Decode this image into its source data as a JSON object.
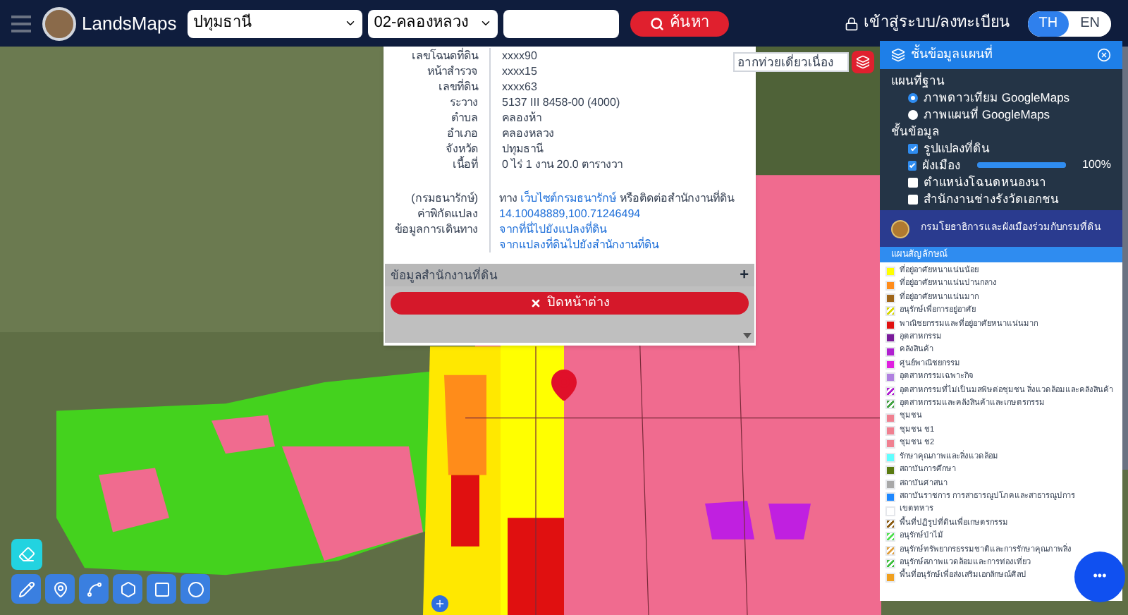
{
  "header": {
    "app_name": "LandsMaps",
    "province_select": "ปทุมธานี",
    "district_select": "02-คลองหลวง",
    "search_button": "ค้นหา",
    "login_link": "เข้าสู่ระบบ/ลงทะเบียน",
    "languages": [
      {
        "label": "TH",
        "selected": true
      },
      {
        "label": "EN",
        "selected": false
      }
    ]
  },
  "parcel_popup": {
    "rows": [
      {
        "label": "เลขโฉนดที่ดิน",
        "value": "xxxx90"
      },
      {
        "label": "หน้าสำรวจ",
        "value": "xxxx15"
      },
      {
        "label": "เลขที่ดิน",
        "value": "xxxx63"
      },
      {
        "label": "ระวาง",
        "value": "5137 III 8458-00 (4000)"
      },
      {
        "label": "ตำบล",
        "value": "คลองห้า"
      },
      {
        "label": "อำเภอ",
        "value": "คลองหลวง"
      },
      {
        "label": "จังหวัด",
        "value": "ปทุมธานี"
      },
      {
        "label": "เนื้อที่",
        "value": "0 ไร่ 1 งาน 20.0 ตารางวา"
      }
    ],
    "extra_rows": [
      {
        "label": "(กรมธนารักษ์)",
        "parts": [
          {
            "text": "ทาง ",
            "link": false
          },
          {
            "text": "เว็บไซต์กรมธนารักษ์",
            "link": true
          },
          {
            "text": " หรือติดต่อสำนักงานที่ดิน",
            "link": false
          }
        ]
      },
      {
        "label": "ค่าพิกัดแปลง",
        "parts": [
          {
            "text": "14.10048889,100.71246494",
            "link": true
          }
        ]
      },
      {
        "label": "ข้อมูลการเดินทาง",
        "parts": [
          {
            "text": "จากที่นี่ไปยังแปลงที่ดิน",
            "link": true
          }
        ]
      },
      {
        "label": "",
        "parts": [
          {
            "text": "จากแปลงที่ดินไปยังสำนักงานที่ดิน",
            "link": true
          }
        ]
      }
    ],
    "section": "ข้อมูลสำนักงานที่ดิน",
    "section_toggle": "+",
    "close_button": "ปิดหน้าต่าง"
  },
  "route_tab": "อากท่วยเดี่ยวเนื่อง",
  "layer_panel": {
    "title": "ชั้นข้อมูลแผนที่",
    "basemap_heading": "แผนที่ฐาน",
    "basemaps": [
      {
        "label": "ภาพดาวเทียม GoogleMaps",
        "selected": true
      },
      {
        "label": "ภาพแผนที่ GoogleMaps",
        "selected": false
      }
    ],
    "layers_heading": "ชั้นข้อมูล",
    "layers": [
      {
        "label": "รูปแปลงที่ดิน",
        "checked": true,
        "kind": "checkbox"
      },
      {
        "label": "ผังเมือง",
        "checked": true,
        "kind": "slider",
        "level": 1,
        "reading": "100%"
      },
      {
        "label": "ตำแหน่งโฉนดหนองนา",
        "checked": false,
        "kind": "checkbox"
      },
      {
        "label": "สำนักงานช่างรังวัดเอกชน",
        "checked": false,
        "kind": "checkbox"
      }
    ],
    "banner": "กรมโยธาธิการและผังเมืองร่วมกับกรมที่ดิน",
    "legend_heading": "แผนสัญลักษณ์",
    "legend": [
      {
        "label": "ที่อยู่อาศัยหนาแน่นน้อย",
        "color": "#ffff00",
        "kind": "solid"
      },
      {
        "label": "ที่อยู่อาศัยหนาแน่นปานกลาง",
        "color": "#ff8c1a",
        "kind": "solid"
      },
      {
        "label": "ที่อยู่อาศัยหนาแน่นมาก",
        "color": "#a0661a",
        "kind": "solid"
      },
      {
        "label": "อนุรักษ์เพื่อการอยู่อาศัย",
        "color": "#d8d800",
        "kind": "hatch"
      },
      {
        "label": "พาณิชยกรรมและที่อยู่อาศัยหนาแน่นมาก",
        "color": "#e01010",
        "kind": "solid"
      },
      {
        "label": "อุตสาหกรรม",
        "color": "#7a1a9a",
        "kind": "solid"
      },
      {
        "label": "คลังสินค้า",
        "color": "#b020d0",
        "kind": "solid"
      },
      {
        "label": "ศูนย์พาณิชยกรรม",
        "color": "#e020e0",
        "kind": "solid"
      },
      {
        "label": "อุตสาหกรรมเฉพาะกิจ",
        "color": "#b080e0",
        "kind": "solid"
      },
      {
        "label": "อุตสาหกรรมที่ไม่เป็นมลพิษต่อชุมชน สิ่งแวดล้อมและคลังสินค้า",
        "color": "#b020d0",
        "kind": "hatch"
      },
      {
        "label": "อุตสาหกรรมและคลังสินค้าและเกษตรกรรม",
        "color": "#40a040",
        "kind": "hatch"
      },
      {
        "label": "ชุมชน",
        "color": "#f08090",
        "kind": "solid"
      },
      {
        "label": "ชุมชน ช1",
        "color": "#f08090",
        "kind": "solid"
      },
      {
        "label": "ชุมชน ช2",
        "color": "#f08090",
        "kind": "solid"
      },
      {
        "label": "รักษาคุณภาพและสิ่งแวดล้อม",
        "color": "#60ffff",
        "kind": "solid"
      },
      {
        "label": "สถาบันการศึกษา",
        "color": "#5a7a10",
        "kind": "solid"
      },
      {
        "label": "สถาบันศาสนา",
        "color": "#a8a8a8",
        "kind": "solid"
      },
      {
        "label": "สถาบันราชการ การสาธารณูปโภคและสาธารณูปการ",
        "color": "#1e88ff",
        "kind": "solid"
      },
      {
        "label": "เขตทหาร",
        "color": "#ffffff",
        "kind": "solid"
      },
      {
        "label": "พื้นที่ปฏิรูปที่ดินเพื่อเกษตรกรรม",
        "color": "#8a5a10",
        "kind": "hatch"
      },
      {
        "label": "อนุรักษ์ป่าไม้",
        "color": "#50e050",
        "kind": "hatch"
      },
      {
        "label": "อนุรักษ์ทรัพยากรธรรมชาติและการรักษาคุณภาพสิ่ง",
        "color": "#e0a040",
        "kind": "hatch"
      },
      {
        "label": "อนุรักษ์สภาพแวดล้อมและการท่องเที่ยว",
        "color": "#40c040",
        "kind": "hatch"
      },
      {
        "label": "พื้นที่อนุรักษ์เพื่อส่งเสริมเอกลักษณ์ศิลป",
        "color": "#f0a020",
        "kind": "solid"
      }
    ]
  },
  "fab": "•••"
}
